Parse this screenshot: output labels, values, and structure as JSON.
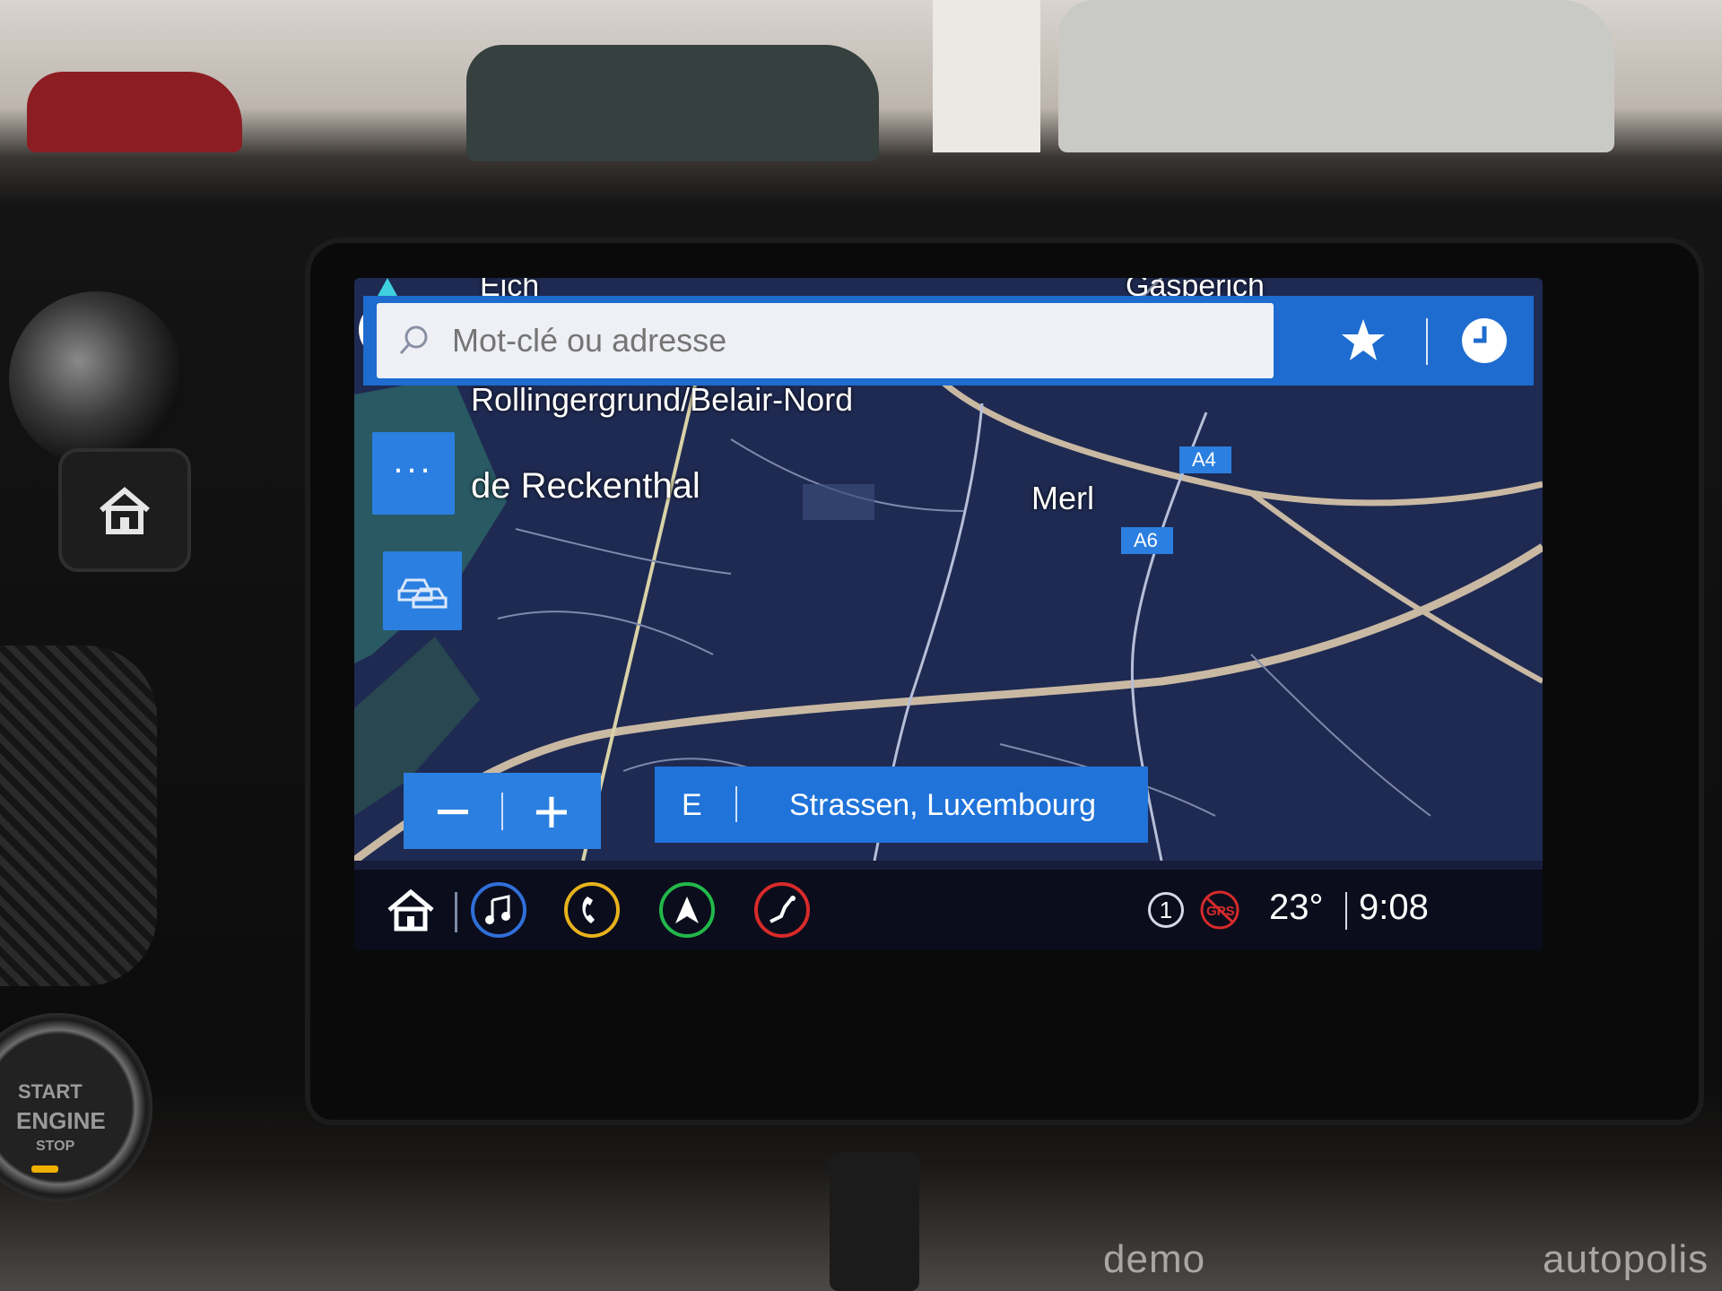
{
  "map": {
    "labels": {
      "top_left": "Eich",
      "top_right": "Gasperich",
      "district": "Rollingergrund/Belair-Nord",
      "street": "de Reckenthal",
      "locality": "Merl"
    },
    "road_shields": [
      "A4",
      "A6"
    ]
  },
  "search": {
    "placeholder": "Mot-clé ou adresse"
  },
  "side_buttons": {
    "more_label": "..."
  },
  "zoom": {
    "minus": "−",
    "plus": "+"
  },
  "location": {
    "heading": "E",
    "place": "Strassen, Luxembourg"
  },
  "status_bar": {
    "message_count": "1",
    "gps_label": "GPS",
    "temperature": "23°",
    "time": "9:08"
  },
  "hardware": {
    "start_line1": "START",
    "start_line2": "ENGINE",
    "start_line3": "STOP"
  },
  "watermark": {
    "left": "demo",
    "right": "autopolis"
  },
  "colors": {
    "accent_blue": "#1e6ccf",
    "music_ring": "#2f6fd8",
    "phone_ring": "#e8b21c",
    "nav_ring": "#22b84a",
    "seat_ring": "#d82a2a",
    "map_background": "#1f2a52"
  },
  "icons": [
    "search-icon",
    "star-icon",
    "clock-icon",
    "more-icon",
    "traffic-icon",
    "home-icon",
    "music-icon",
    "phone-icon",
    "navigation-icon",
    "seat-icon",
    "gps-off-icon"
  ]
}
